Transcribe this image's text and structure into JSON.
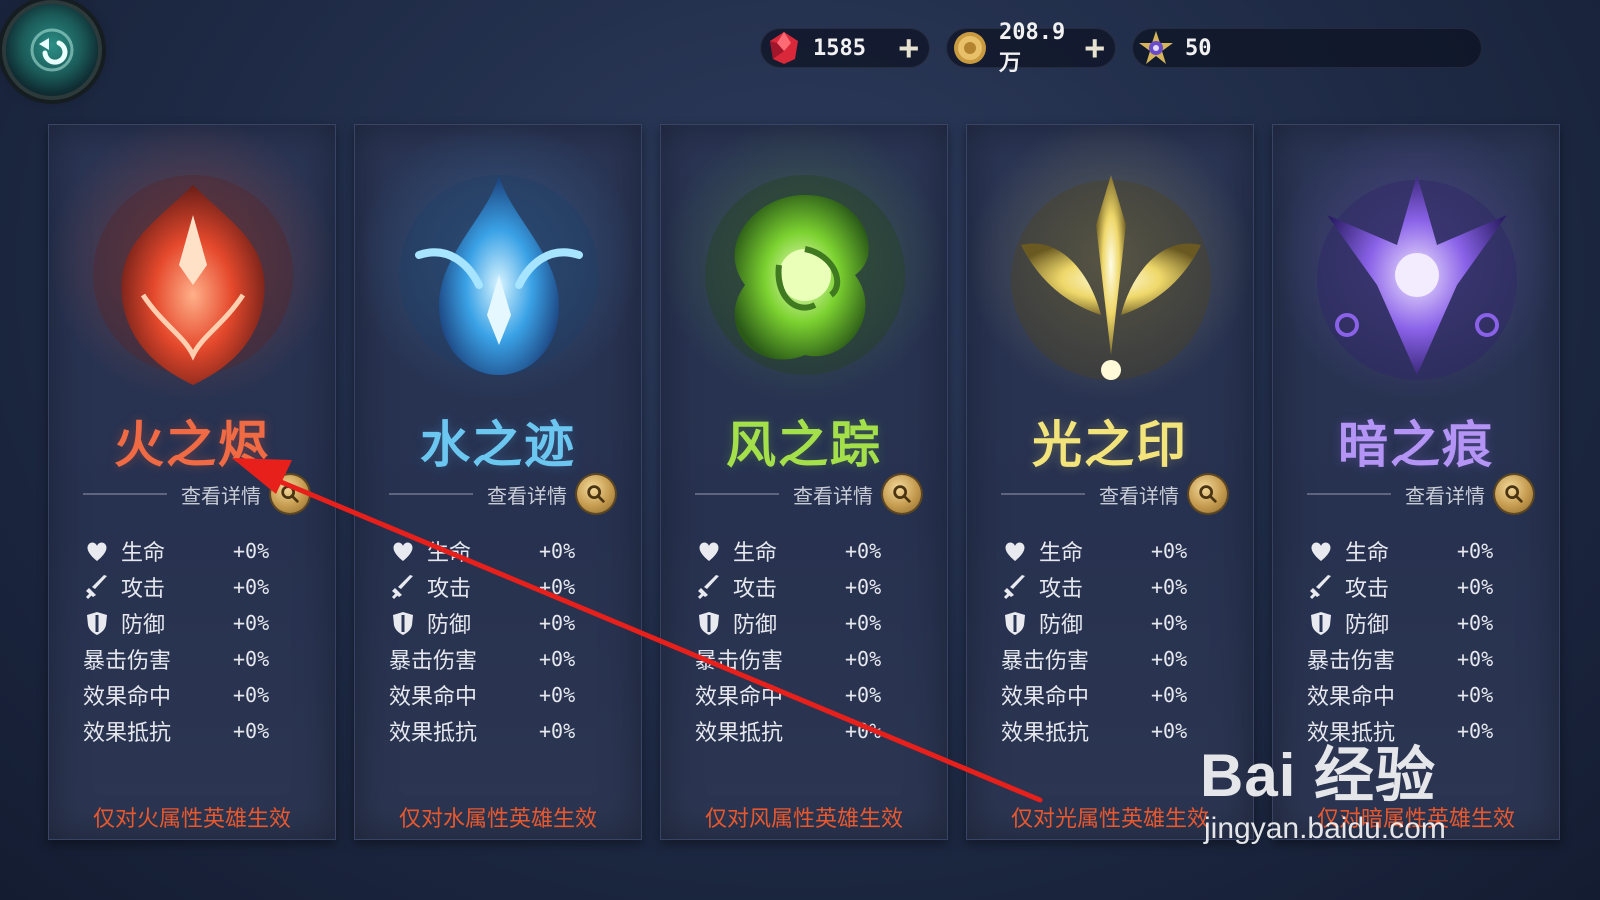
{
  "currencies": [
    {
      "name": "gem",
      "value": "1585",
      "has_plus": true
    },
    {
      "name": "gold",
      "value": "208.9万",
      "has_plus": true
    },
    {
      "name": "star",
      "value": "50",
      "has_plus": false
    }
  ],
  "detail_label": "查看详情",
  "stat_values": "+0%",
  "cards": [
    {
      "title": "火之烬",
      "color": "#f06a44",
      "note": "仅对火属性英雄生效",
      "stats": [
        "生命",
        "攻击",
        "防御",
        "暴击伤害",
        "效果命中",
        "效果抵抗"
      ]
    },
    {
      "title": "水之迹",
      "color": "#6cc7f0",
      "note": "仅对水属性英雄生效",
      "stats": [
        "生命",
        "攻击",
        "防御",
        "暴击伤害",
        "效果命中",
        "效果抵抗"
      ]
    },
    {
      "title": "风之踪",
      "color": "#a4e04a",
      "note": "仅对风属性英雄生效",
      "stats": [
        "生命",
        "攻击",
        "防御",
        "暴击伤害",
        "效果命中",
        "效果抵抗"
      ]
    },
    {
      "title": "光之印",
      "color": "#f2e37a",
      "note": "仅对光属性英雄生效",
      "stats": [
        "生命",
        "攻击",
        "防御",
        "暴击伤害",
        "效果命中",
        "效果抵抗"
      ]
    },
    {
      "title": "暗之痕",
      "color": "#b494f4",
      "note": "仅对暗属性英雄生效",
      "stats": [
        "生命",
        "攻击",
        "防御",
        "暴击伤害",
        "效果命中",
        "效果抵抗"
      ]
    }
  ],
  "watermark": {
    "logo": "Bai 经验",
    "url": "jingyan.baidu.com"
  },
  "annotation": {
    "type": "red-arrow",
    "points_to": "火之烬"
  }
}
